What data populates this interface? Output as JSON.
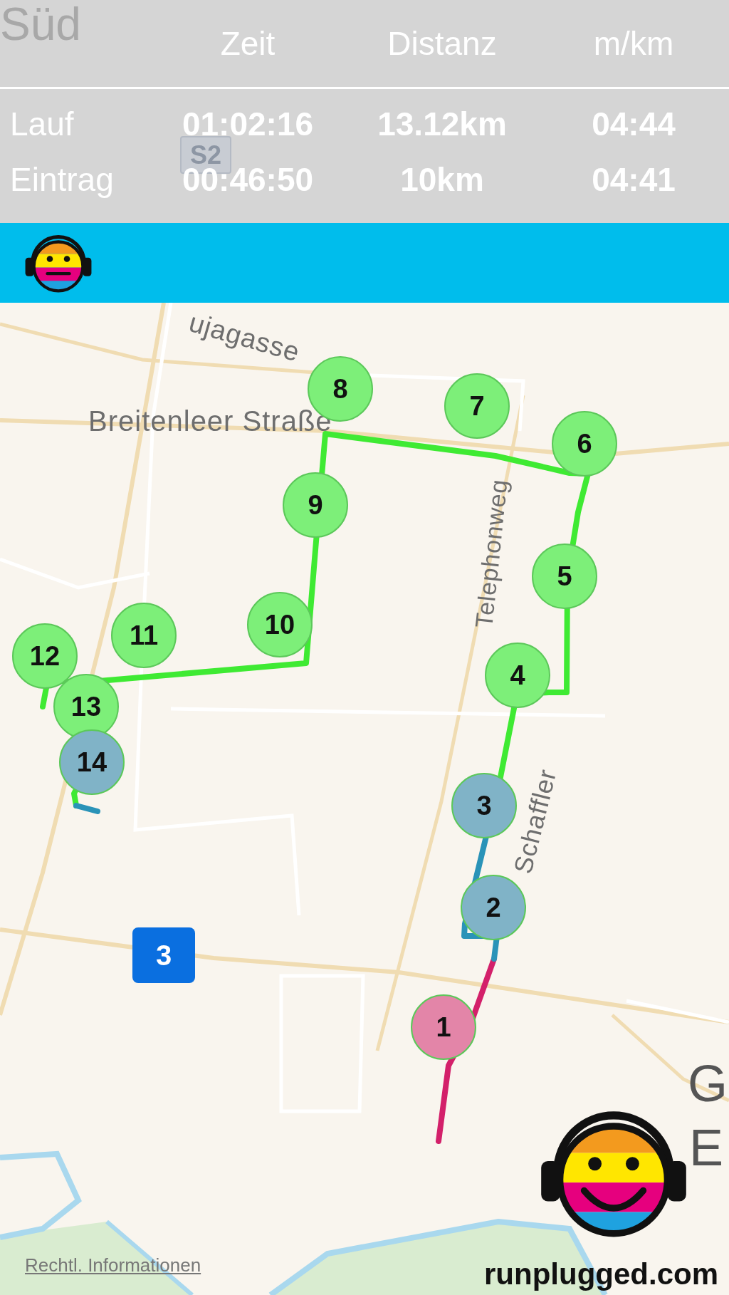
{
  "header": {
    "faded_map_label": "Süd",
    "faded_route_sign": "S2",
    "columns": [
      "Zeit",
      "Distanz",
      "m/km"
    ],
    "rows": [
      {
        "label": "Lauf",
        "values": [
          "01:02:16",
          "13.12km",
          "04:44"
        ]
      },
      {
        "label": "Eintrag",
        "values": [
          "00:46:50",
          "10km",
          "04:41"
        ]
      }
    ]
  },
  "map": {
    "labels": [
      "ujagasse",
      "Breitenleer Straße",
      "Telephonweg",
      "Schaffler",
      "G",
      "E"
    ],
    "markers": [
      {
        "label": "1",
        "color": "#e385a8"
      },
      {
        "label": "2",
        "color": "#80b3c7"
      },
      {
        "label": "3",
        "color": "#80b3c7"
      },
      {
        "label": "4",
        "color": "#7def79"
      },
      {
        "label": "5",
        "color": "#7def79"
      },
      {
        "label": "6",
        "color": "#7def79"
      },
      {
        "label": "7",
        "color": "#7def79"
      },
      {
        "label": "8",
        "color": "#7def79"
      },
      {
        "label": "9",
        "color": "#7def79"
      },
      {
        "label": "10",
        "color": "#7def79"
      },
      {
        "label": "11",
        "color": "#7def79"
      },
      {
        "label": "12",
        "color": "#7def79"
      },
      {
        "label": "13",
        "color": "#7def79"
      },
      {
        "label": "14",
        "color": "#80b3c7"
      }
    ],
    "road_badge": "3",
    "legal_link": "Rechtl. Informationen",
    "brand": "runplugged.com"
  }
}
